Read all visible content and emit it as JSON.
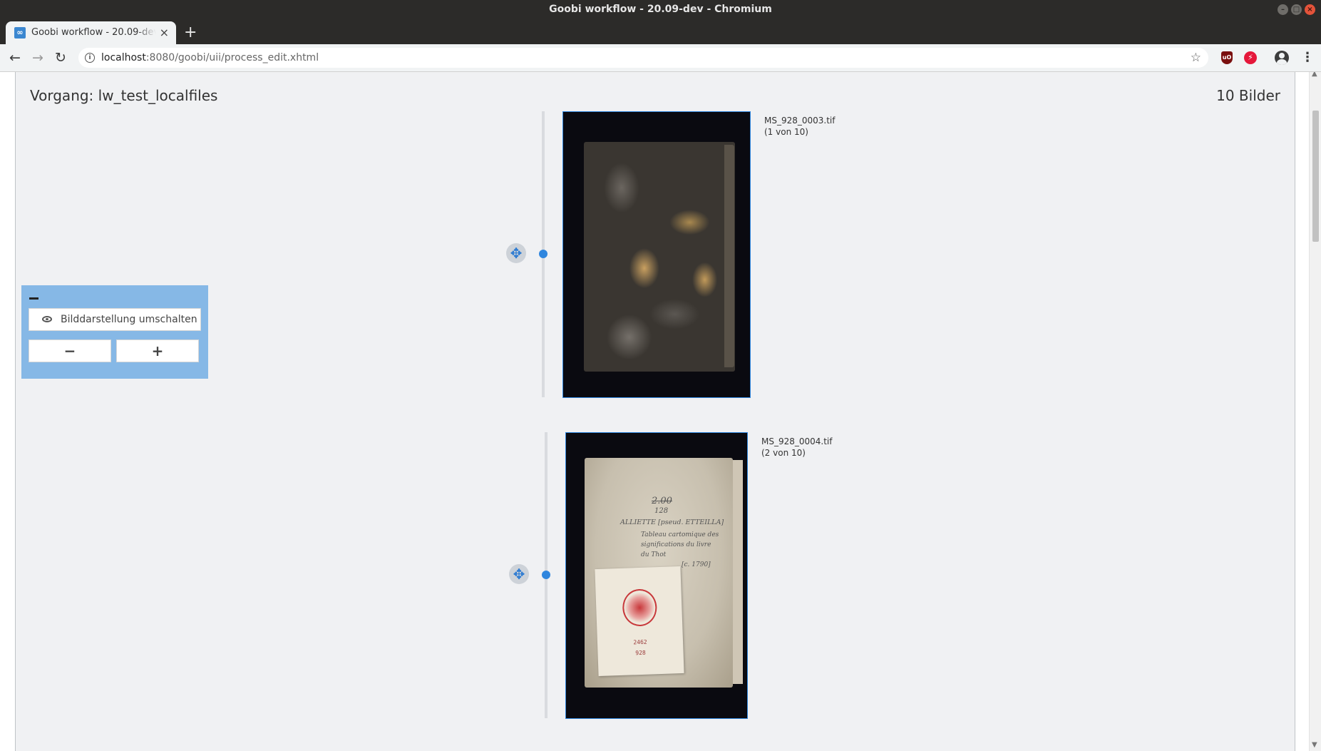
{
  "window": {
    "title": "Goobi workflow - 20.09-dev - Chromium"
  },
  "browser": {
    "tab_title": "Goobi workflow - 20.09-dev - Chromium",
    "url_host": "localhost",
    "url_path": ":8080/goobi/uii/process_edit.xhtml"
  },
  "page": {
    "title": "Vorgang: lw_test_localfiles",
    "image_count": "10 Bilder"
  },
  "controls": {
    "toggle_label": "Bilddarstellung umschalten",
    "zoom_out_label": "−",
    "zoom_in_label": "+"
  },
  "images": [
    {
      "filename": "MS_928_0003.tif",
      "position": "(1 von 10)"
    },
    {
      "filename": "MS_928_0004.tif",
      "position": "(2 von 10)"
    }
  ],
  "handwriting": {
    "line1": "2.00",
    "line2": "128",
    "line3": "ALLIETTE [pseud. ETTEILLA]",
    "line4": "Tableau cartomique des",
    "line5": "significations du livre",
    "line6": "du Thot",
    "line7": "[c. 1790]",
    "card1": "2462",
    "card2": "928"
  }
}
